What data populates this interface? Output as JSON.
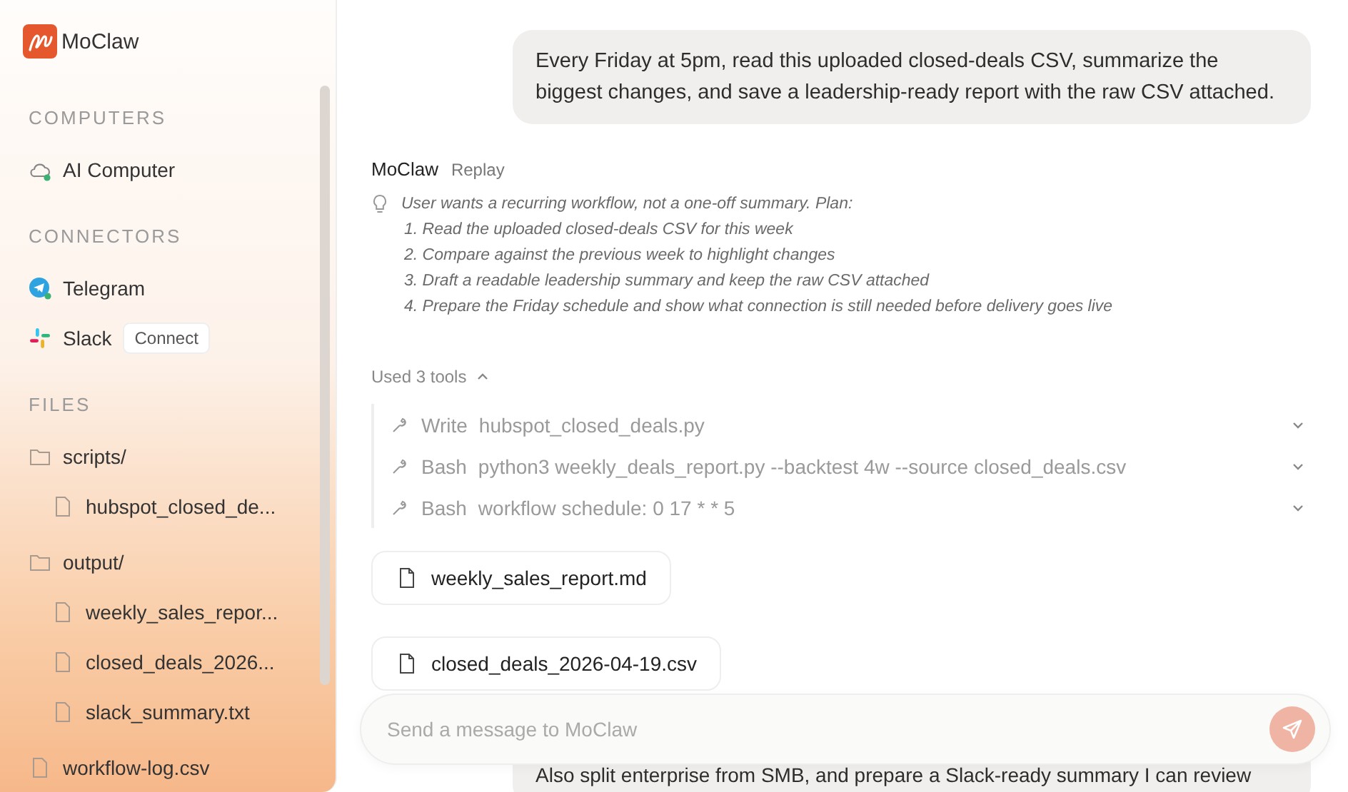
{
  "sidebar": {
    "brand": "MoClaw",
    "sections": [
      {
        "title": "COMPUTERS",
        "kind": "computers",
        "items": [
          {
            "label": "AI Computer",
            "connected": true
          }
        ]
      },
      {
        "title": "CONNECTORS",
        "kind": "connectors",
        "items": [
          {
            "label": "Telegram",
            "connected": true
          },
          {
            "label": "Slack",
            "connected": false,
            "action": "Connect"
          }
        ]
      },
      {
        "title": "FILES",
        "kind": "files",
        "items": [
          {
            "label": "scripts/",
            "kind": "folder",
            "children": [
              {
                "label": "hubspot_closed_de...",
                "kind": "file"
              }
            ]
          },
          {
            "label": "output/",
            "kind": "folder",
            "children": [
              {
                "label": "weekly_sales_repor...",
                "kind": "file"
              },
              {
                "label": "closed_deals_2026...",
                "kind": "file"
              },
              {
                "label": "slack_summary.txt",
                "kind": "file"
              }
            ]
          },
          {
            "label": "workflow-log.csv",
            "kind": "file"
          }
        ]
      }
    ]
  },
  "chat": {
    "messages": [
      {
        "kind": "user",
        "text": "Every Friday at 5pm, read this uploaded closed-deals CSV, summarize the biggest changes, and save a leadership-ready report with the raw CSV attached."
      },
      {
        "kind": "assistant",
        "author": "MoClaw",
        "action": "Replay",
        "thinking": [
          "User wants a recurring workflow, not a one-off summary. Plan:",
          "1. Read the uploaded closed-deals CSV for this week",
          "2. Compare against the previous week to highlight changes",
          "3. Draft a readable leadership summary and keep the raw CSV attached",
          "4. Prepare the Friday schedule and show what connection is still needed before delivery goes live"
        ],
        "tools_label": "Used 3 tools",
        "tools_expanded": true,
        "tools": [
          {
            "name": "Write",
            "detail": "hubspot_closed_deals.py",
            "expanded": false
          },
          {
            "name": "Bash",
            "detail": "python3 weekly_deals_report.py --backtest 4w --source closed_deals.csv",
            "expanded": false
          },
          {
            "name": "Bash",
            "detail": "workflow schedule: 0 17 * * 5",
            "expanded": false
          }
        ],
        "files": [
          "weekly_sales_report.md",
          "closed_deals_2026-04-19.csv"
        ]
      },
      {
        "kind": "user",
        "text": "Also split enterprise from SMB, and prepare a Slack-ready summary I can review"
      }
    ]
  },
  "composer": {
    "placeholder": "Send a message to MoClaw"
  }
}
